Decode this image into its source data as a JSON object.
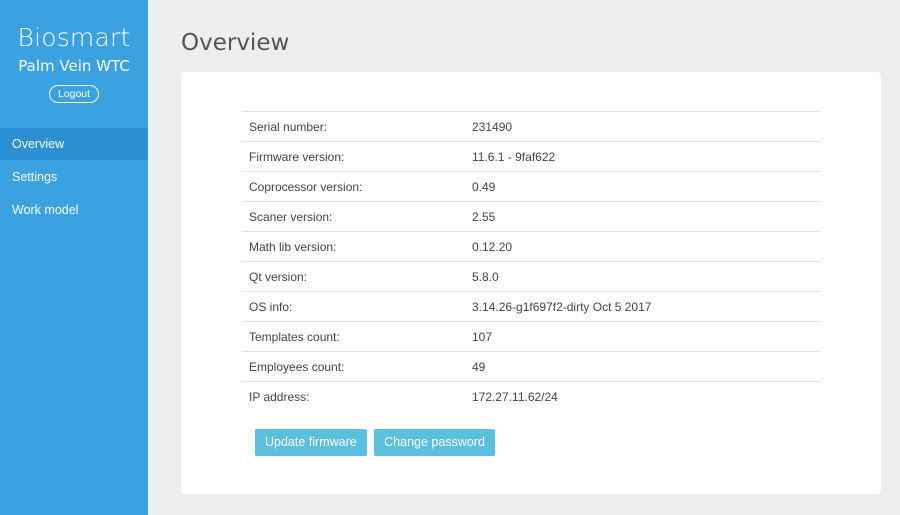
{
  "sidebar": {
    "brand": "Biosmart",
    "device": "Palm Vein WTC",
    "logout_label": "Logout",
    "items": [
      {
        "label": "Overview",
        "active": true
      },
      {
        "label": "Settings",
        "active": false
      },
      {
        "label": "Work model",
        "active": false
      }
    ]
  },
  "main": {
    "title": "Overview",
    "rows": [
      {
        "label": "Serial number:",
        "value": "231490"
      },
      {
        "label": "Firmware version:",
        "value": "11.6.1 - 9faf622"
      },
      {
        "label": "Coprocessor version:",
        "value": "0.49"
      },
      {
        "label": "Scaner version:",
        "value": "2.55"
      },
      {
        "label": "Math lib version:",
        "value": "0.12.20"
      },
      {
        "label": "Qt version:",
        "value": "5.8.0"
      },
      {
        "label": "OS info:",
        "value": "3.14.26-g1f697f2-dirty Oct 5 2017"
      },
      {
        "label": "Templates count:",
        "value": "107"
      },
      {
        "label": "Employees count:",
        "value": "49"
      },
      {
        "label": "IP address:",
        "value": "172.27.11.62/24"
      }
    ],
    "buttons": {
      "update_firmware": "Update firmware",
      "change_password": "Change password"
    }
  },
  "colors": {
    "sidebar": "#3aa2e0",
    "sidebar_active": "#2b8fd3",
    "button": "#5bc0de",
    "background": "#eceef0"
  }
}
